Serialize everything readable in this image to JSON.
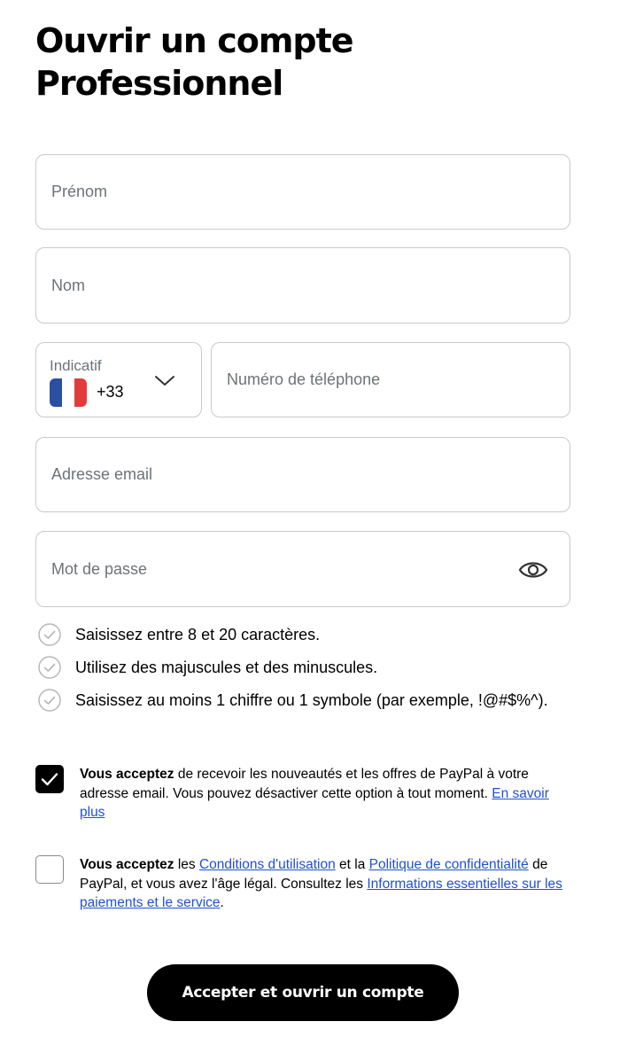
{
  "page": {
    "title_line1": "Ouvrir un compte",
    "title_line2": "Professionnel"
  },
  "form": {
    "first_name": {
      "placeholder": "Prénom",
      "value": ""
    },
    "last_name": {
      "placeholder": "Nom",
      "value": ""
    },
    "phone_code": {
      "label": "Indicatif",
      "value": "+33",
      "flag_icon": "france-flag-icon"
    },
    "phone_number": {
      "placeholder": "Numéro de téléphone",
      "value": ""
    },
    "email": {
      "placeholder": "Adresse email",
      "value": ""
    },
    "password": {
      "placeholder": "Mot de passe",
      "value": "",
      "toggle_icon": "eye-icon"
    }
  },
  "password_rules": [
    "Saisissez entre 8 et 20 caractères.",
    "Utilisez des majuscules et des minuscules.",
    "Saisissez au moins 1 chiffre ou 1 symbole (par exemple, !@#$%^)."
  ],
  "consents": {
    "marketing": {
      "checked": true,
      "bold": "Vous acceptez",
      "text": " de recevoir les nouveautés et les offres de PayPal à votre adresse email. Vous pouvez désactiver cette option à tout moment. ",
      "link": "En savoir plus"
    },
    "terms": {
      "checked": false,
      "bold": "Vous acceptez",
      "text1": " les ",
      "link1": "Conditions d'utilisation",
      "text2": " et la ",
      "link2": "Politique de confidentialité",
      "text3": " de PayPal, et vous avez l'âge légal. Consultez les ",
      "link3": "Informations essentielles sur les paiements et le service",
      "text4": "."
    }
  },
  "submit_label": "Accepter et ouvrir un compte",
  "colors": {
    "link": "#1f4fd6",
    "primary_button": "#000000",
    "border": "#c9c9c9",
    "placeholder": "#6c7378"
  }
}
